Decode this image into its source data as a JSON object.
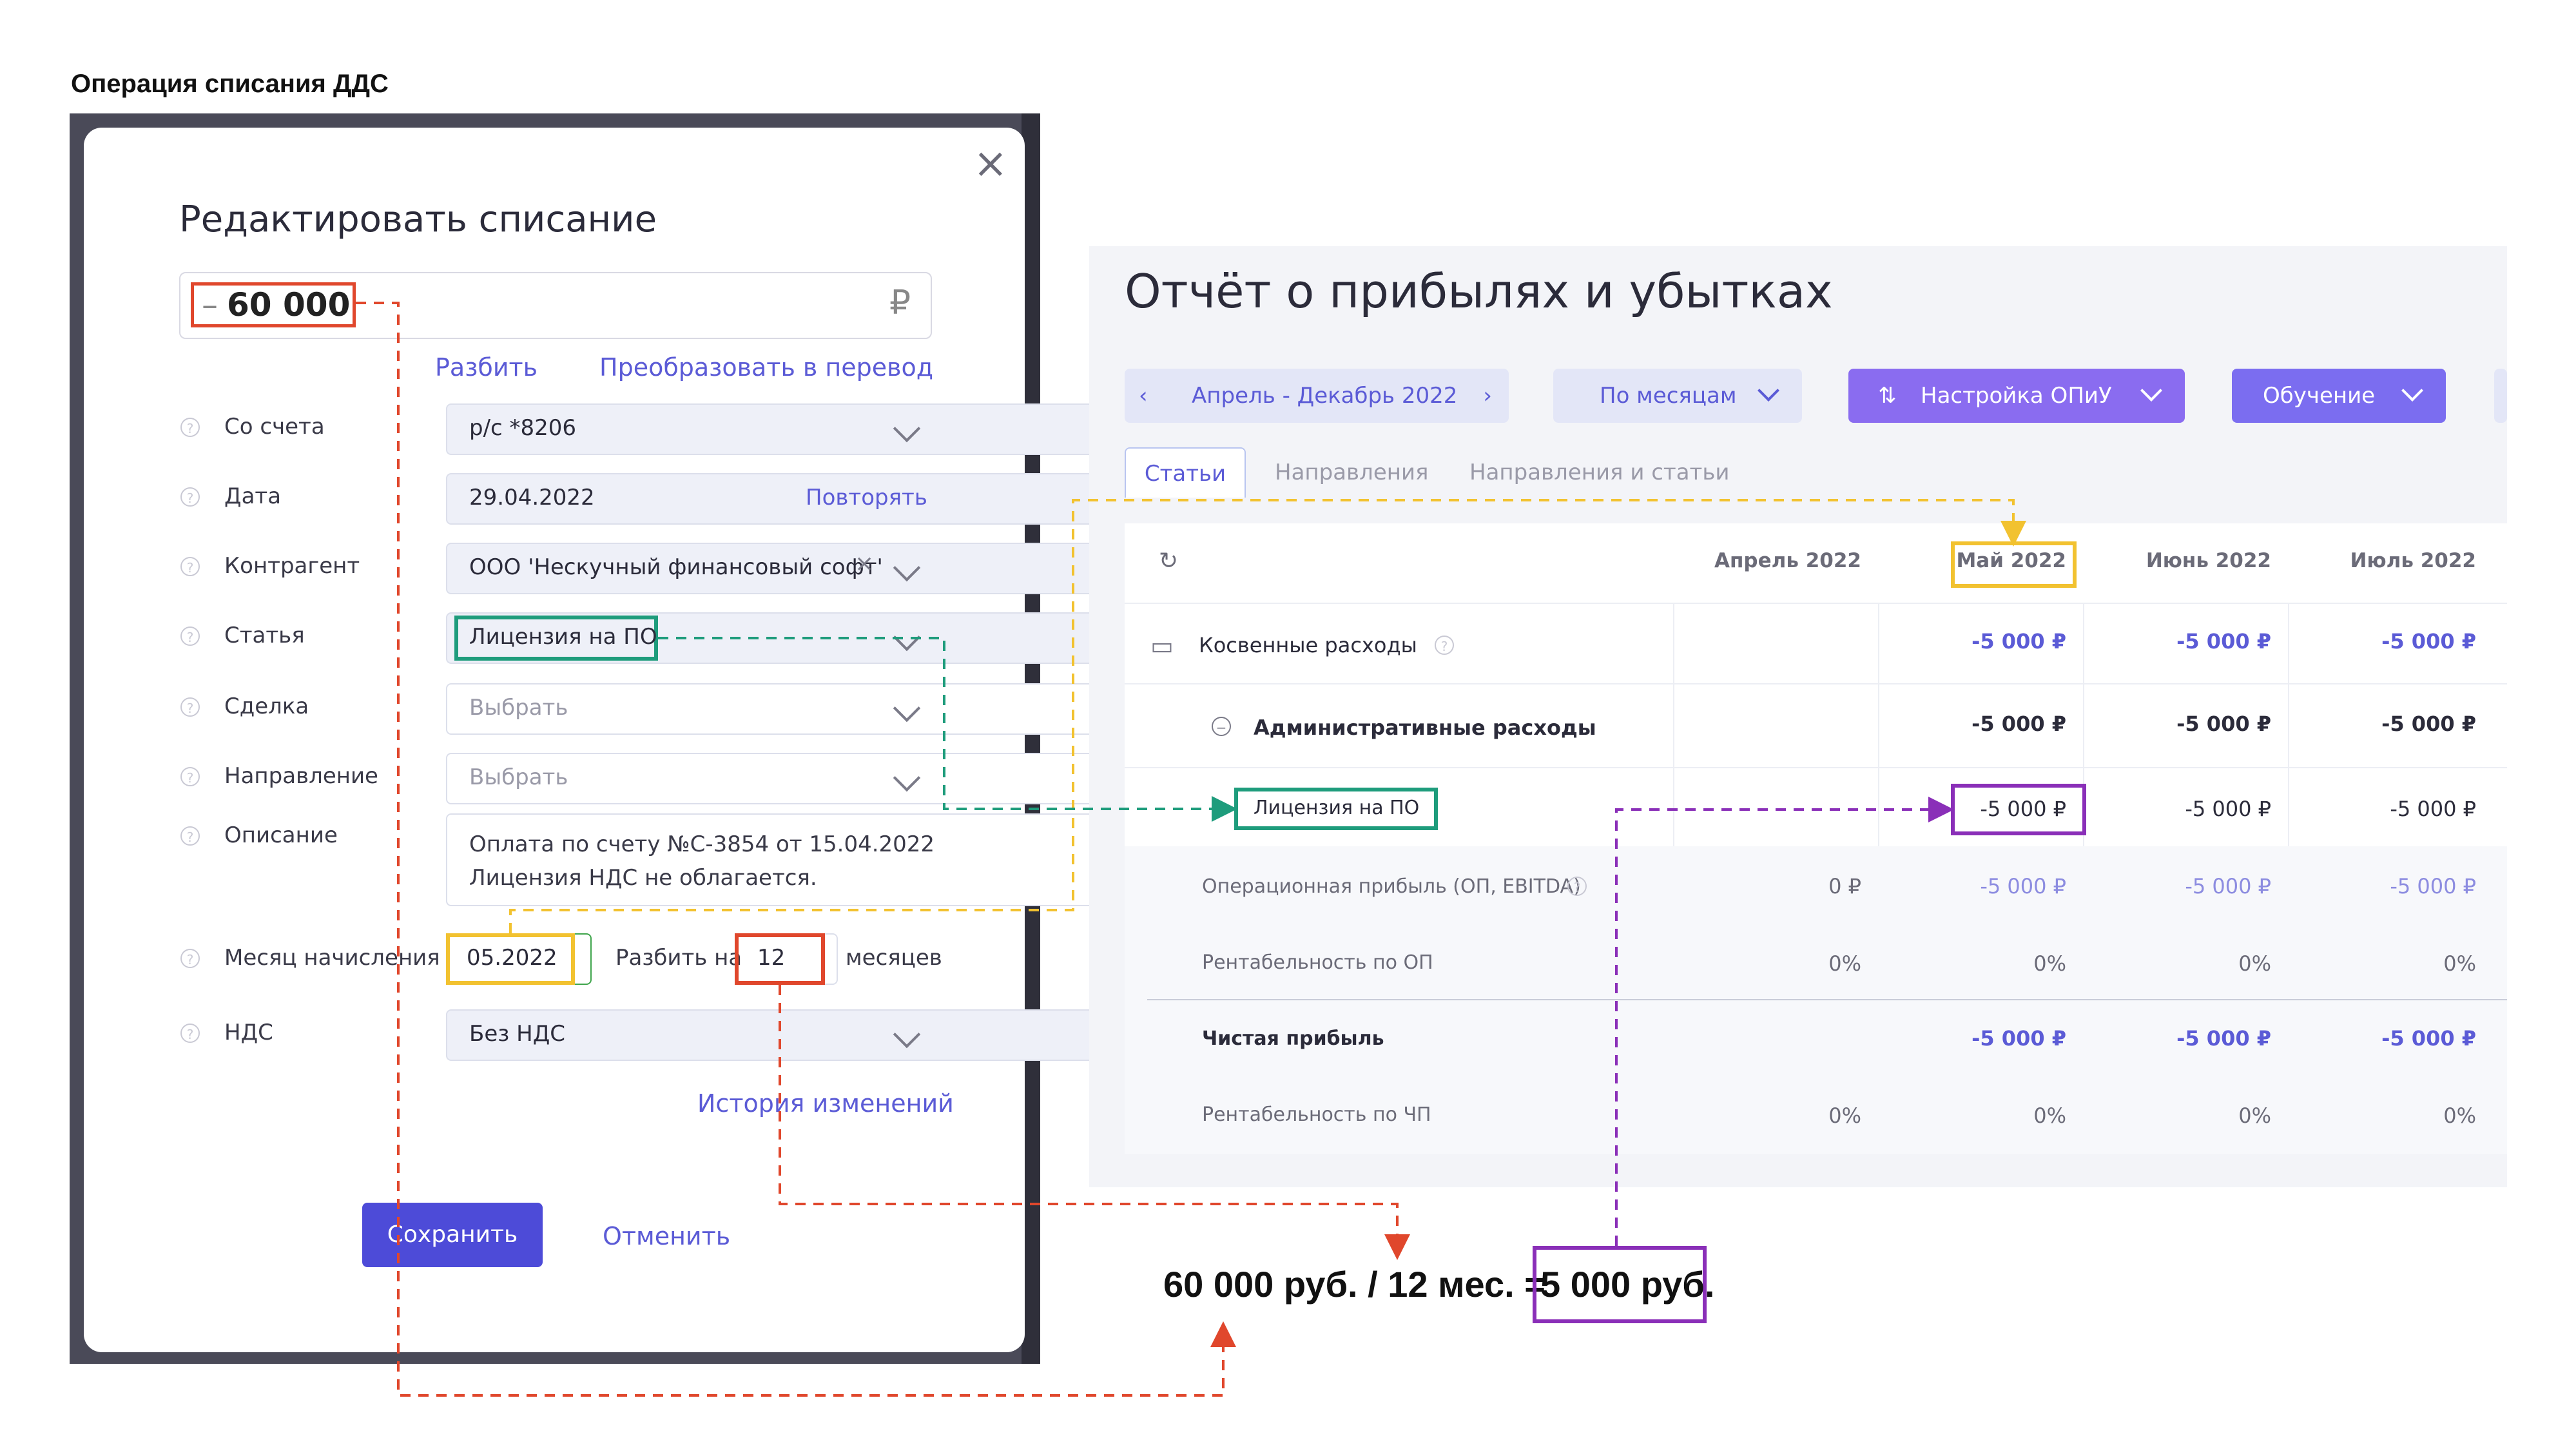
{
  "page_heading": "Операция списания ДДС",
  "modal": {
    "title": "Редактировать списание",
    "amount_sign": "–",
    "amount": "60 000",
    "currency": "₽",
    "link_split": "Разбить",
    "link_convert": "Преобразовать в перевод",
    "fields": {
      "account": {
        "label": "Со счета",
        "value": "р/с *8206"
      },
      "date": {
        "label": "Дата",
        "value": "29.04.2022",
        "action": "Повторять"
      },
      "counterparty": {
        "label": "Контрагент",
        "value": "ООО 'Нескучный финансовый софт'"
      },
      "article": {
        "label": "Статья",
        "value": "Лицензия на ПО"
      },
      "deal": {
        "label": "Сделка",
        "placeholder": "Выбрать"
      },
      "direction": {
        "label": "Направление",
        "placeholder": "Выбрать"
      },
      "description": {
        "label": "Описание",
        "line1": "Оплата по счету №С-3854 от 15.04.2022",
        "line2": "Лицензия НДС не облагается."
      },
      "accrual_month": {
        "label": "Месяц начисления",
        "value": "05.2022",
        "split_label": "Разбить на",
        "split_value": "12",
        "split_unit": "месяцев"
      },
      "vat": {
        "label": "НДС",
        "value": "Без НДС"
      }
    },
    "history_link": "История изменений",
    "save_label": "Сохранить",
    "cancel_label": "Отменить"
  },
  "report": {
    "title": "Отчёт о прибылях и убытках",
    "period": "Апрель - Декабрь 2022",
    "grouping": "По месяцам",
    "setup": "Настройка ОПиУ",
    "learning": "Обучение",
    "tabs": [
      "Статьи",
      "Направления",
      "Направления и статьи"
    ],
    "columns": [
      "Апрель 2022",
      "Май 2022",
      "Июнь 2022",
      "Июль 2022"
    ],
    "rows": [
      {
        "label": "Косвенные расходы",
        "values": [
          "",
          "-5 000 ₽",
          "-5 000 ₽",
          "-5 000 ₽"
        ]
      },
      {
        "label": "Административные расходы",
        "values": [
          "",
          "-5 000 ₽",
          "-5 000 ₽",
          "-5 000 ₽"
        ]
      },
      {
        "label": "Лицензия на ПО",
        "values": [
          "",
          "-5 000 ₽",
          "-5 000 ₽",
          "-5 000 ₽"
        ]
      },
      {
        "label": "Операционная прибыль (ОП, EBITDA)",
        "values": [
          "0 ₽",
          "-5 000 ₽",
          "-5 000 ₽",
          "-5 000 ₽"
        ]
      },
      {
        "label": "Рентабельность по ОП",
        "values": [
          "0%",
          "0%",
          "0%",
          "0%"
        ]
      },
      {
        "label": "Чистая прибыль",
        "values": [
          "",
          "-5 000 ₽",
          "-5 000 ₽",
          "-5 000 ₽"
        ]
      },
      {
        "label": "Рентабельность по ЧП",
        "values": [
          "0%",
          "0%",
          "0%",
          "0%"
        ]
      }
    ]
  },
  "formula": {
    "text": "60 000 руб. / 12 мес. =",
    "result": "5 000 руб."
  },
  "colors": {
    "accent": "#5b5bd6",
    "red_marker": "#e0472c",
    "yellow_marker": "#f2c230",
    "green_marker": "#1e9c7c",
    "purple_marker": "#8a2fb8"
  }
}
